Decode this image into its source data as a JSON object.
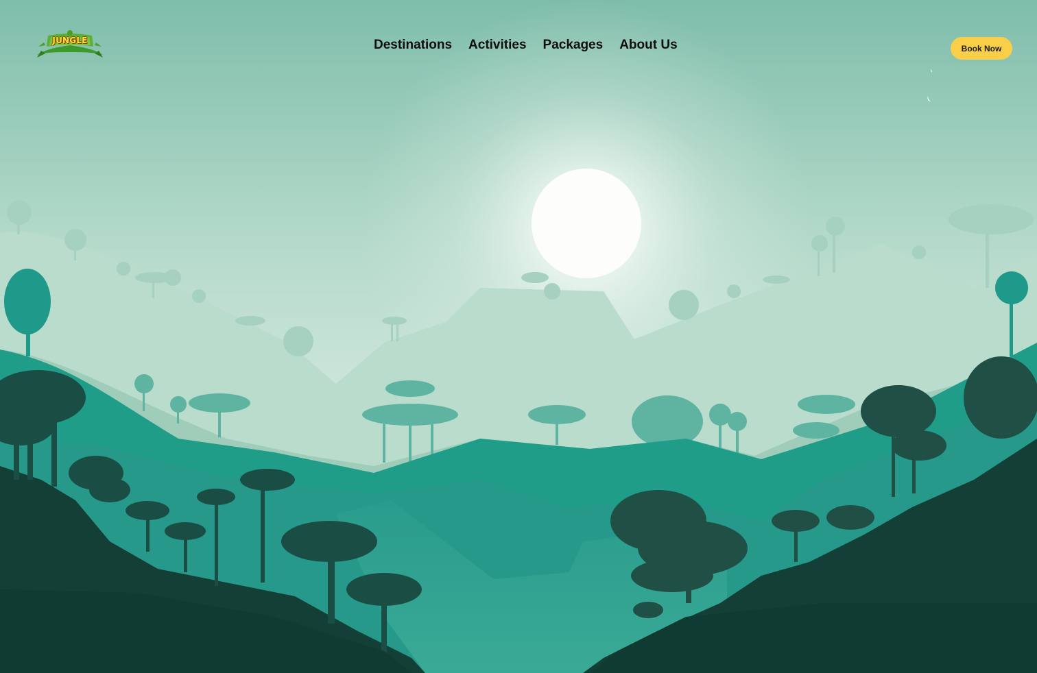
{
  "header": {
    "logo_text": "JUNGLE",
    "book_button_label": "Book Now"
  },
  "nav": {
    "items": [
      {
        "label": "Destinations"
      },
      {
        "label": "Activities"
      },
      {
        "label": "Packages"
      },
      {
        "label": "About Us"
      }
    ]
  },
  "theme": {
    "accent": "#f9cf4a",
    "sky_top": "#7fbdab",
    "sky_glow": "#e4f1ea",
    "forest_dark": "#123f36",
    "forest_mid": "#27998a"
  },
  "icons": {
    "logo": "jungle-leaf-logo",
    "sun": "sun-icon",
    "birds": "bird-icon"
  }
}
